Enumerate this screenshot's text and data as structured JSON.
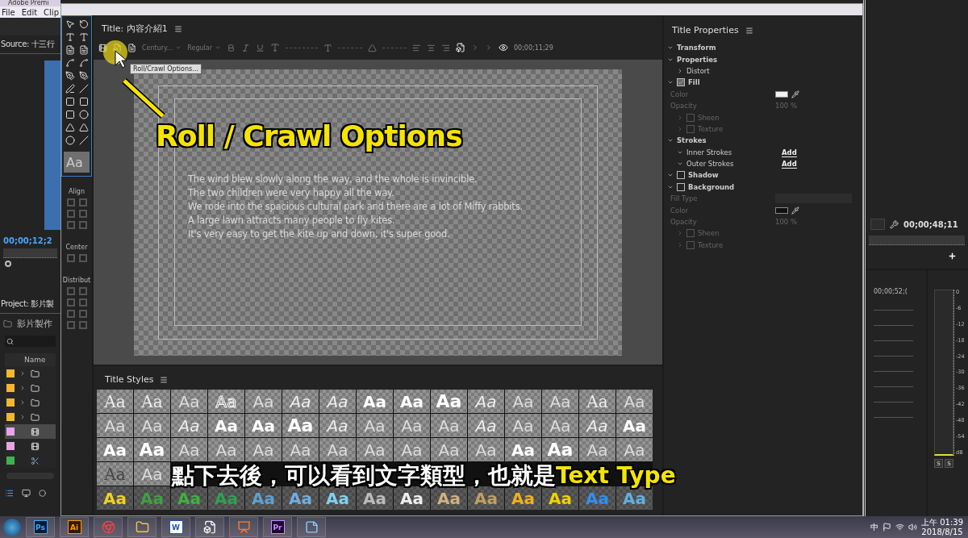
{
  "app": {
    "title": "Adobe Premi",
    "menu": [
      "File",
      "Edit",
      "Clip"
    ]
  },
  "source_panel": {
    "label": "Source: 十三行",
    "timecode": "00;00;12;2"
  },
  "project_panel": {
    "label": "Project: 影片製",
    "bin": "影片製作",
    "column": "Name",
    "items": [
      {
        "kind": "folder",
        "color": "#f2b534",
        "selected": false
      },
      {
        "kind": "folder",
        "color": "#f2b534",
        "selected": false
      },
      {
        "kind": "folder",
        "color": "#f2b534",
        "selected": false
      },
      {
        "kind": "folder",
        "color": "#f2b534",
        "selected": false
      },
      {
        "kind": "sequence",
        "color": "#e8a4e8",
        "selected": true
      },
      {
        "kind": "sequence",
        "color": "#e8a4e8",
        "selected": false
      },
      {
        "kind": "clip",
        "color": "#3fb24f",
        "selected": false
      }
    ]
  },
  "title_window": {
    "title": "Title: 內容介紹1",
    "font": "Century...",
    "style": "Regular",
    "timecode": "00;00;11;29",
    "tooltip": "Roll/Crawl Options...",
    "swatch": "Aa",
    "sections": [
      "Align",
      "Center",
      "Distribut"
    ],
    "text_lines": [
      "The wind blew slowly along the way, and the whole is invincible.",
      "The two children were very happy all the way.",
      "We rode into the spacious cultural park and there are a lot of Miffy rabbits.",
      "A large lawn attracts many people to fly kites.",
      "It's very easy to get the kite up and down, it's super good."
    ]
  },
  "title_styles": {
    "title": "Title Styles",
    "rows": [
      [
        {
          "text": "Aa",
          "kind": "serif"
        },
        {
          "text": "Aa",
          "kind": "serif"
        },
        {
          "text": "Aa",
          "kind": "sans"
        },
        {
          "text": "Aa",
          "kind": "outline"
        },
        {
          "text": "Aa",
          "kind": "sans"
        },
        {
          "text": "Aa",
          "kind": "script"
        },
        {
          "text": "Aa",
          "kind": "script"
        },
        {
          "text": "Aa",
          "kind": "bold"
        },
        {
          "text": "Aa",
          "kind": "bold"
        },
        {
          "text": "Aa",
          "kind": "heavy"
        },
        {
          "text": "Aa",
          "kind": "script"
        },
        {
          "text": "Aa",
          "kind": "sans"
        },
        {
          "text": "Aa",
          "kind": "sans"
        },
        {
          "text": "Aa",
          "kind": "serif"
        },
        {
          "text": "Aa",
          "kind": "sans"
        }
      ],
      [
        {
          "text": "Aa",
          "kind": "sans"
        },
        {
          "text": "Aa",
          "kind": "sans"
        },
        {
          "text": "Aa",
          "kind": "script"
        },
        {
          "text": "Aa",
          "kind": "bold"
        },
        {
          "text": "Aa",
          "kind": "bold"
        },
        {
          "text": "Aa",
          "kind": "heavy"
        },
        {
          "text": "Aa",
          "kind": "script"
        },
        {
          "text": "Aa",
          "kind": "sans"
        },
        {
          "text": "Aa",
          "kind": "sans"
        },
        {
          "text": "Aa",
          "kind": "sans"
        },
        {
          "text": "Aa",
          "kind": "script"
        },
        {
          "text": "Aa",
          "kind": "sans"
        },
        {
          "text": "Aa",
          "kind": "sans"
        },
        {
          "text": "Aa",
          "kind": "script"
        },
        {
          "text": "Aa",
          "kind": "bold"
        }
      ],
      [
        {
          "text": "Aa",
          "kind": "bold"
        },
        {
          "text": "Aa",
          "kind": "heavy"
        },
        {
          "text": "Aa",
          "kind": "sans"
        },
        {
          "text": "Aa",
          "kind": "sans"
        },
        {
          "text": "Aa",
          "kind": "sans"
        },
        {
          "text": "Aa",
          "kind": "sans"
        },
        {
          "text": "Aa",
          "kind": "sans"
        },
        {
          "text": "Aa",
          "kind": "sans"
        },
        {
          "text": "Aa",
          "kind": "sans"
        },
        {
          "text": "Aa",
          "kind": "sans"
        },
        {
          "text": "Aa",
          "kind": "sans"
        },
        {
          "text": "Aa",
          "kind": "bold"
        },
        {
          "text": "Aa",
          "kind": "heavy"
        },
        {
          "text": "Aa",
          "kind": "sans"
        },
        {
          "text": "Aa",
          "kind": "sans"
        }
      ],
      [
        {
          "text": "Aa",
          "kind": "dark"
        },
        {
          "text": "Aa",
          "kind": "sans"
        }
      ],
      [
        {
          "text": "Aa",
          "kind": "colored",
          "color": "#f0d020"
        },
        {
          "text": "Aa",
          "kind": "colored",
          "color": "#40a040"
        },
        {
          "text": "Aa",
          "kind": "colored",
          "color": "#40b040"
        },
        {
          "text": "Aa",
          "kind": "colored",
          "color": "#30a050"
        },
        {
          "text": "Aa",
          "kind": "colored",
          "color": "#60a0d0"
        },
        {
          "text": "Aa",
          "kind": "colored",
          "color": "#70aee0"
        },
        {
          "text": "Aa",
          "kind": "colored",
          "color": "#80d0f0"
        },
        {
          "text": "Aa",
          "kind": "colored",
          "color": "#bbbbbb"
        },
        {
          "text": "Aa",
          "kind": "colored",
          "color": "#eeeeee"
        },
        {
          "text": "Aa",
          "kind": "colored",
          "color": "#d0b080"
        },
        {
          "text": "Aa",
          "kind": "colored",
          "color": "#c0a060"
        },
        {
          "text": "Aa",
          "kind": "colored",
          "color": "#f0b020"
        },
        {
          "text": "Aa",
          "kind": "colored",
          "color": "#f0d000"
        },
        {
          "text": "Aa",
          "kind": "colored",
          "color": "#3090f0"
        },
        {
          "text": "Aa",
          "kind": "colored",
          "color": "#60b0e0"
        }
      ]
    ]
  },
  "properties": {
    "title": "Title Properties",
    "sections": [
      {
        "label": "Transform",
        "expanded": true
      },
      {
        "label": "Properties",
        "expanded": true,
        "children": [
          {
            "kind": "group",
            "label": "Distort",
            "expanded": false,
            "disabled": false
          }
        ]
      },
      {
        "label": "Fill",
        "expanded": true,
        "checked": true,
        "children": [
          {
            "kind": "color",
            "label": "Color",
            "color": "#f2f2f2",
            "disabled": true
          },
          {
            "kind": "value",
            "label": "Opacity",
            "value": "100 %",
            "disabled": true
          },
          {
            "kind": "check",
            "label": "Sheen",
            "checked": false,
            "expanded": false,
            "disabled": true
          },
          {
            "kind": "check",
            "label": "Texture",
            "checked": false,
            "expanded": false,
            "disabled": true
          }
        ]
      },
      {
        "label": "Strokes",
        "expanded": true,
        "children": [
          {
            "kind": "add",
            "label": "Inner Strokes",
            "action": "Add",
            "expanded": true,
            "disabled": false
          },
          {
            "kind": "add",
            "label": "Outer Strokes",
            "action": "Add",
            "expanded": true,
            "disabled": false
          }
        ]
      },
      {
        "label": "Shadow",
        "expanded": true,
        "checked": false
      },
      {
        "label": "Background",
        "expanded": true,
        "checked": false,
        "children": [
          {
            "kind": "select",
            "label": "Fill Type",
            "disabled": true
          },
          {
            "kind": "color",
            "label": "Color",
            "color": "#111111",
            "disabled": true
          },
          {
            "kind": "value",
            "label": "Opacity",
            "value": "100 %",
            "disabled": true
          },
          {
            "kind": "check",
            "label": "Sheen",
            "checked": false,
            "expanded": false,
            "disabled": true
          },
          {
            "kind": "check",
            "label": "Texture",
            "checked": false,
            "expanded": false,
            "disabled": true
          }
        ]
      }
    ]
  },
  "program_panel": {
    "timecode": "00;00;48;11"
  },
  "timeline": {
    "timecode": "00;00;52;("
  },
  "audio_meter": {
    "scale": [
      "0",
      "-6",
      "-12",
      "-18",
      "-24",
      "-30",
      "-36",
      "-42",
      "-48",
      "-54",
      "dB"
    ],
    "solo_buttons": [
      "S",
      "S"
    ]
  },
  "annotation": {
    "label": "Roll / Crawl Options"
  },
  "subtitle": {
    "text": "點下去後，可以看到文字類型，也就是**Text Type**"
  },
  "taskbar": {
    "apps": [
      {
        "kind": "ps",
        "label": "Ps"
      },
      {
        "kind": "ai",
        "label": "Ai"
      },
      {
        "kind": "chrome"
      },
      {
        "kind": "folder"
      },
      {
        "kind": "word",
        "label": "W"
      },
      {
        "kind": "box"
      },
      {
        "kind": "slides"
      },
      {
        "kind": "pr",
        "label": "Pr"
      },
      {
        "kind": "notepad"
      }
    ],
    "ime": "中",
    "time": "上午 01:39",
    "date": "2018/8/15"
  }
}
